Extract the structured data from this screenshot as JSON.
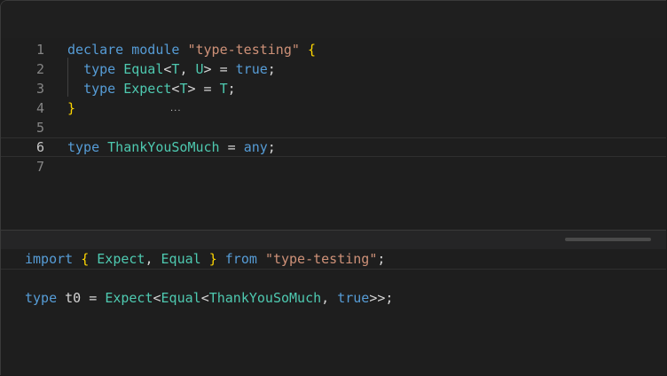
{
  "editor": {
    "lines": [
      {
        "num": "1",
        "tokens": [
          {
            "t": "declare",
            "c": "kw"
          },
          {
            "t": " ",
            "c": "pl"
          },
          {
            "t": "module",
            "c": "kw"
          },
          {
            "t": " ",
            "c": "pl"
          },
          {
            "t": "\"type-testing\"",
            "c": "str"
          },
          {
            "t": " ",
            "c": "pl"
          },
          {
            "t": "{",
            "c": "br"
          }
        ]
      },
      {
        "num": "2",
        "tokens": [
          {
            "t": "  ",
            "c": "pl"
          },
          {
            "t": "type",
            "c": "kw"
          },
          {
            "t": " ",
            "c": "pl"
          },
          {
            "t": "Equal",
            "c": "ty"
          },
          {
            "t": "<",
            "c": "pl"
          },
          {
            "t": "T",
            "c": "ty"
          },
          {
            "t": ", ",
            "c": "pl"
          },
          {
            "t": "U",
            "c": "ty"
          },
          {
            "t": "> = ",
            "c": "pl"
          },
          {
            "t": "true",
            "c": "kw"
          },
          {
            "t": ";",
            "c": "pl"
          }
        ]
      },
      {
        "num": "3",
        "tokens": [
          {
            "t": "  ",
            "c": "pl"
          },
          {
            "t": "type",
            "c": "kw"
          },
          {
            "t": " ",
            "c": "pl"
          },
          {
            "t": "Expect",
            "c": "ty"
          },
          {
            "t": "<",
            "c": "pl"
          },
          {
            "t": "T",
            "c": "ty"
          },
          {
            "t": "> = ",
            "c": "pl"
          },
          {
            "t": "T",
            "c": "ty"
          },
          {
            "t": ";",
            "c": "pl"
          }
        ]
      },
      {
        "num": "4",
        "tokens": [
          {
            "t": "}",
            "c": "br"
          }
        ]
      },
      {
        "num": "5",
        "tokens": []
      },
      {
        "num": "6",
        "tokens": [
          {
            "t": "type",
            "c": "kw"
          },
          {
            "t": " ",
            "c": "pl"
          },
          {
            "t": "ThankYouSoMuch",
            "c": "ty"
          },
          {
            "t": " = ",
            "c": "pl"
          },
          {
            "t": "any",
            "c": "kw"
          },
          {
            "t": ";",
            "c": "pl"
          }
        ]
      },
      {
        "num": "7",
        "tokens": []
      }
    ],
    "active_line": "6"
  },
  "preview": {
    "lines": [
      {
        "tokens": [
          {
            "t": "import",
            "c": "kw"
          },
          {
            "t": " ",
            "c": "pl"
          },
          {
            "t": "{",
            "c": "br"
          },
          {
            "t": " ",
            "c": "pl"
          },
          {
            "t": "Expect",
            "c": "ty"
          },
          {
            "t": ", ",
            "c": "pl"
          },
          {
            "t": "Equal",
            "c": "ty"
          },
          {
            "t": " ",
            "c": "pl"
          },
          {
            "t": "}",
            "c": "br"
          },
          {
            "t": " ",
            "c": "pl"
          },
          {
            "t": "from",
            "c": "kw"
          },
          {
            "t": " ",
            "c": "pl"
          },
          {
            "t": "\"type-testing\"",
            "c": "str"
          },
          {
            "t": ";",
            "c": "pl"
          }
        ]
      },
      {
        "tokens": []
      },
      {
        "tokens": [
          {
            "t": "type",
            "c": "kw"
          },
          {
            "t": " ",
            "c": "pl"
          },
          {
            "t": "t0",
            "c": "pl"
          },
          {
            "t": " = ",
            "c": "pl"
          },
          {
            "t": "Expect",
            "c": "ty"
          },
          {
            "t": "<",
            "c": "pl"
          },
          {
            "t": "Equal",
            "c": "ty"
          },
          {
            "t": "<",
            "c": "pl"
          },
          {
            "t": "ThankYouSoMuch",
            "c": "ty"
          },
          {
            "t": ", ",
            "c": "pl"
          },
          {
            "t": "true",
            "c": "kw"
          },
          {
            "t": ">>;",
            "c": "pl"
          }
        ]
      }
    ]
  }
}
